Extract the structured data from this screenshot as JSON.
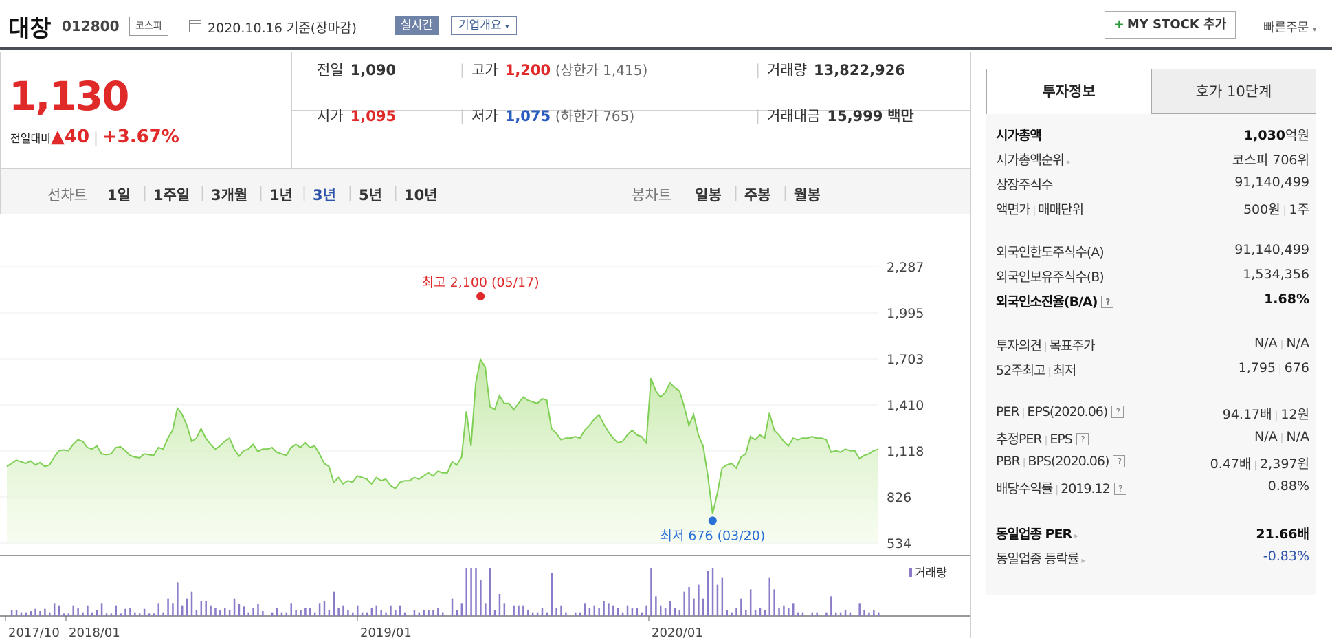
{
  "header": {
    "stock_name": "대창",
    "stock_code": "012800",
    "market_badge": "코스피",
    "date_label": "2020.10.16  기준(장마감)",
    "realtime_label": "실시간",
    "company_info_label": "기업개요",
    "my_stock_label": "MY STOCK 추가",
    "quick_order_label": "빠른주문"
  },
  "price": {
    "current": "1,130",
    "diff_label": "전일대비",
    "diff_value": "40",
    "diff_pct": "+3.67%",
    "prev_close_label": "전일",
    "prev_close": "1,090",
    "open_label": "시가",
    "open": "1,095",
    "high_label": "고가",
    "high": "1,200",
    "upper_limit": "(상한가 1,415)",
    "low_label": "저가",
    "low": "1,075",
    "lower_limit": "(하한가 765)",
    "volume_label": "거래량",
    "volume": "13,822,926",
    "amount_label": "거래대금",
    "amount": "15,999",
    "amount_unit": "백만"
  },
  "chart_tabs": {
    "line_label": "선차트",
    "periods": [
      "1일",
      "1주일",
      "3개월",
      "1년",
      "3년",
      "5년",
      "10년"
    ],
    "active_period": "3년",
    "candle_label": "봉차트",
    "candles": [
      "일봉",
      "주봉",
      "월봉"
    ]
  },
  "chart_data": {
    "type": "area",
    "y_ticks": [
      "2,287",
      "1,995",
      "1,703",
      "1,410",
      "1,118",
      "826",
      "534"
    ],
    "ylim": [
      534,
      2287
    ],
    "x_ticks": [
      "2017/10",
      "2018/01",
      "2019/01",
      "2020/01"
    ],
    "max_annotation": "최고 2,100 (05/17)",
    "min_annotation": "최저 676 (03/20)",
    "volume_legend": "거래량",
    "series": [
      {
        "values": [
          1020,
          1040,
          1060,
          1050,
          1040,
          1055,
          1030,
          1045,
          1020,
          1030,
          1080,
          1120,
          1125,
          1120,
          1160,
          1190,
          1180,
          1140,
          1130,
          1150,
          1100,
          1095,
          1100,
          1140,
          1145,
          1120,
          1090,
          1080,
          1075,
          1100,
          1095,
          1090,
          1140,
          1130,
          1200,
          1250,
          1390,
          1350,
          1280,
          1180,
          1200,
          1260,
          1200,
          1160,
          1130,
          1150,
          1180,
          1200,
          1130,
          1085,
          1120,
          1130,
          1160,
          1115,
          1130,
          1130,
          1140,
          1110,
          1100,
          1090,
          1140,
          1160,
          1140,
          1170,
          1140,
          1150,
          1100,
          1040,
          1020,
          920,
          950,
          910,
          930,
          920,
          960,
          950,
          940,
          910,
          950,
          930,
          940,
          900,
          880,
          920,
          930,
          930,
          950,
          940,
          960,
          980,
          960,
          990,
          980,
          980,
          1050,
          1030,
          1080,
          1370,
          1150,
          1550,
          1700,
          1650,
          1400,
          1380,
          1470,
          1420,
          1420,
          1380,
          1420,
          1460,
          1440,
          1430,
          1420,
          1450,
          1440,
          1260,
          1230,
          1190,
          1200,
          1200,
          1210,
          1200,
          1250,
          1280,
          1320,
          1350,
          1290,
          1240,
          1200,
          1170,
          1180,
          1220,
          1250,
          1220,
          1210,
          1170,
          1580,
          1500,
          1460,
          1490,
          1550,
          1520,
          1500,
          1400,
          1280,
          1350,
          1220,
          1150,
          960,
          720,
          850,
          1010,
          1030,
          1040,
          1010,
          1080,
          1100,
          1210,
          1190,
          1220,
          1200,
          1360,
          1250,
          1220,
          1180,
          1150,
          1200,
          1190,
          1200,
          1200,
          1210,
          1200,
          1200,
          1190,
          1110,
          1120,
          1110,
          1130,
          1120,
          1120,
          1070,
          1090,
          1100,
          1120,
          1130
        ]
      }
    ]
  },
  "invest": {
    "tab_active": "투자정보",
    "tab_other": "호가 10단계",
    "market_cap_label": "시가총액",
    "market_cap": "1,030",
    "market_cap_unit": "억원",
    "rank_label": "시가총액순위",
    "rank": "코스피 706위",
    "shares_label": "상장주식수",
    "shares": "91,140,499",
    "face_label": "액면가",
    "unit_label": "매매단위",
    "face_value": "500원",
    "trade_unit": "1주",
    "foreign_limit_label": "외국인한도주식수(A)",
    "foreign_limit": "91,140,499",
    "foreign_hold_label": "외국인보유주식수(B)",
    "foreign_hold": "1,534,356",
    "foreign_ratio_label": "외국인소진율(B/A)",
    "foreign_ratio": "1.68%",
    "opinion_label": "투자의견",
    "target_label": "목표주가",
    "opinion": "N/A",
    "target": "N/A",
    "w52_high_label": "52주최고",
    "w52_low_label": "최저",
    "w52_high": "1,795",
    "w52_low": "676",
    "per_label": "PER",
    "eps_label": "EPS(2020.06)",
    "per": "94.17배",
    "eps": "12원",
    "est_per_label": "추정PER",
    "est_eps_label": "EPS",
    "est_per": "N/A",
    "est_eps": "N/A",
    "pbr_label": "PBR",
    "bps_label": "BPS(2020.06)",
    "pbr": "0.47배",
    "bps": "2,397원",
    "div_label": "배당수익률",
    "div_year": "2019.12",
    "div": "0.88%",
    "ind_per_label": "동일업종 PER",
    "ind_per": "21.66배",
    "ind_chg_label": "동일업종 등락률",
    "ind_chg": "-0.83%"
  }
}
